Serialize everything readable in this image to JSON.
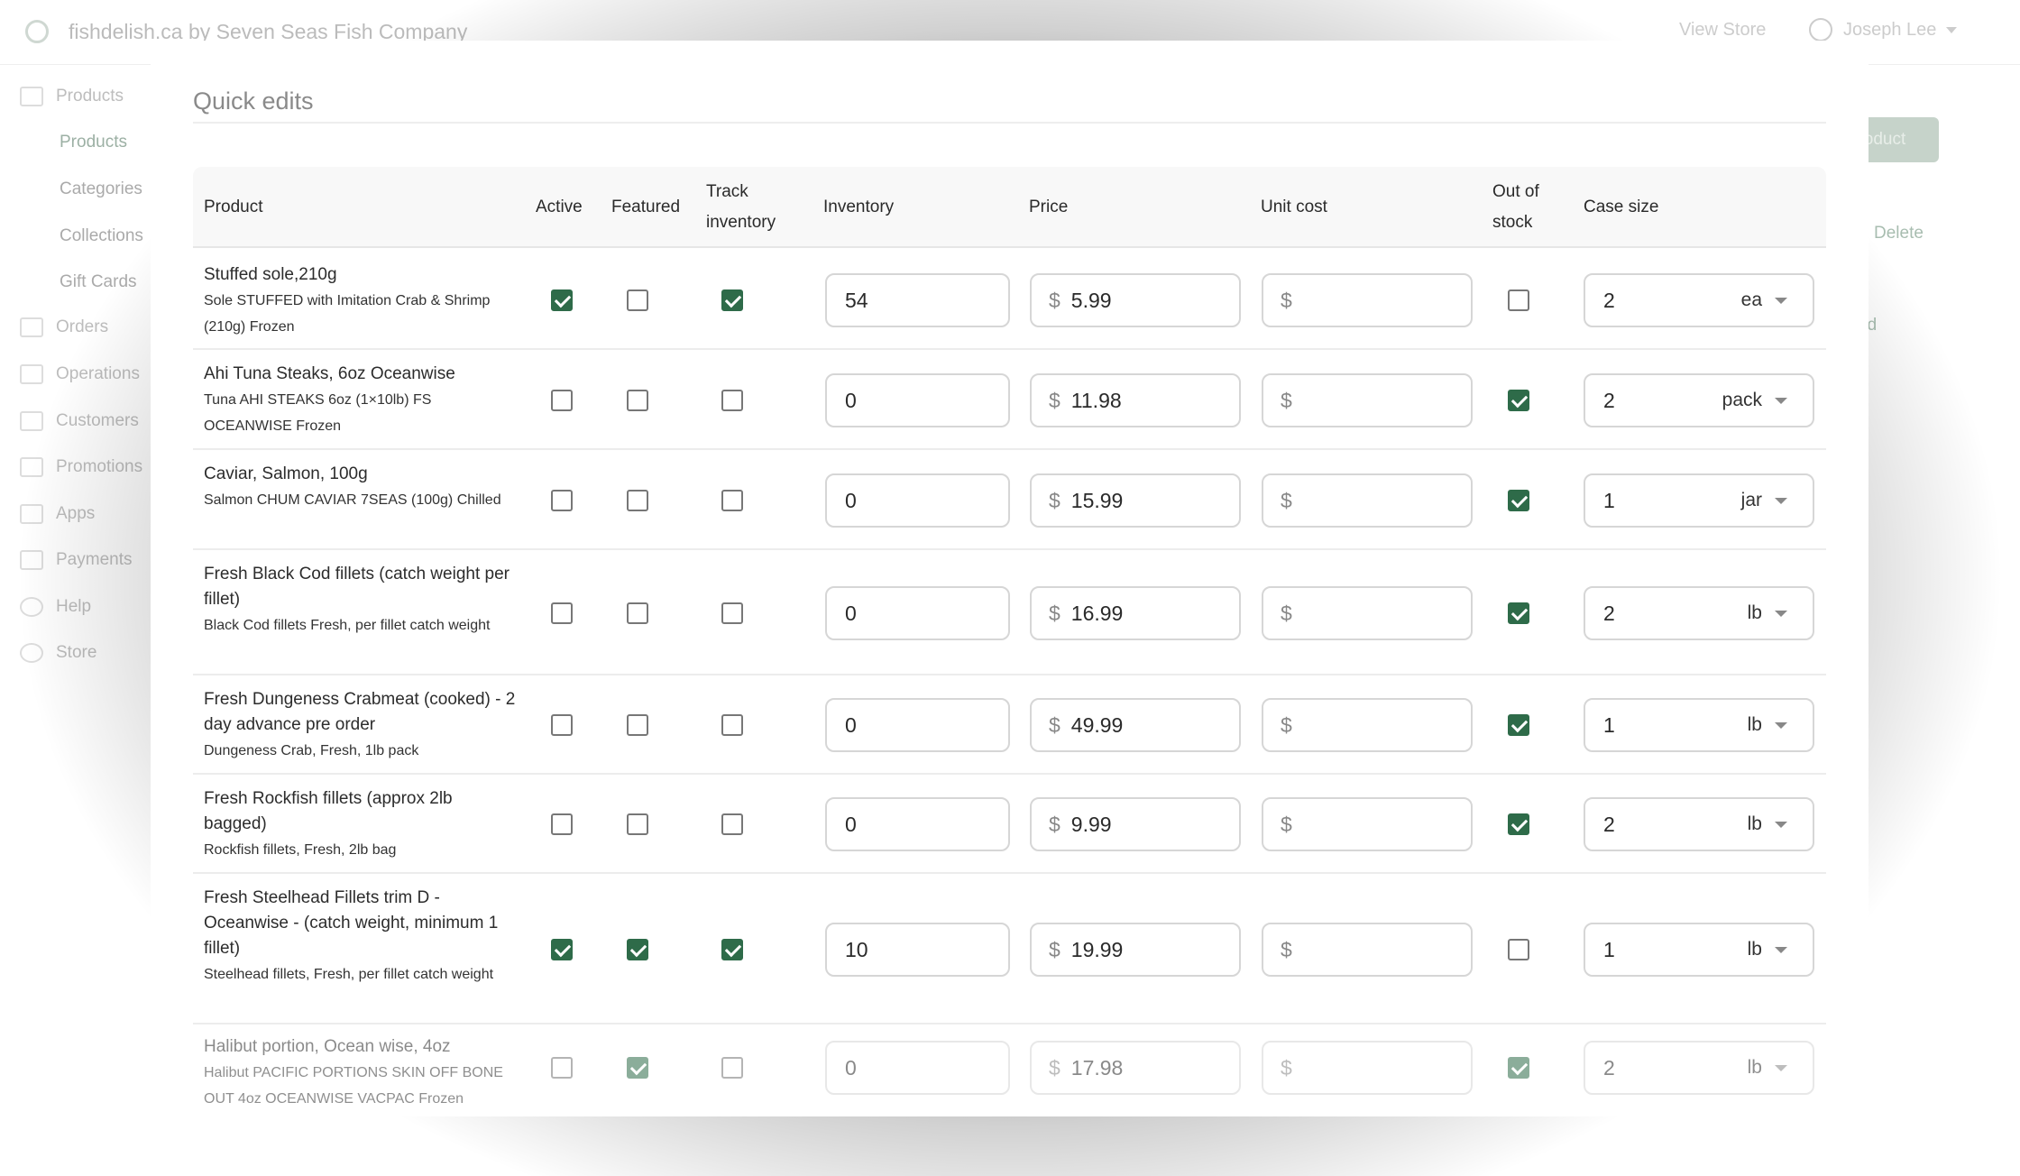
{
  "app": {
    "store_title": "fishdelish.ca by Seven Seas Fish Company",
    "view_store": "View Store",
    "user_name": "Joseph Lee",
    "add_button_label": "oduct",
    "delete_label": "Delete",
    "bg_text_ed": "ed"
  },
  "sidebar": {
    "section": "Products",
    "sub_items": [
      "Products",
      "Categories",
      "Collections",
      "Gift Cards"
    ],
    "items": [
      "Orders",
      "Operations",
      "Customers",
      "Promotions",
      "Apps",
      "Payments",
      "Help",
      "Store"
    ]
  },
  "modal": {
    "title": "Quick edits",
    "columns": {
      "product": "Product",
      "active": "Active",
      "featured": "Featured",
      "track_1": "Track",
      "track_2": "inventory",
      "inventory": "Inventory",
      "price": "Price",
      "unit_cost": "Unit cost",
      "oos_1": "Out of",
      "oos_2": "stock",
      "case_size": "Case size"
    },
    "currency_symbol": "$",
    "rows": [
      {
        "name": "Stuffed sole,210g",
        "desc": "Sole STUFFED with Imitation Crab & Shrimp (210g) Frozen",
        "active": true,
        "featured": false,
        "track": true,
        "inventory": "54",
        "price": "5.99",
        "unit_cost": "",
        "out_of_stock": false,
        "case_qty": "2",
        "case_unit": "ea"
      },
      {
        "name": "Ahi Tuna Steaks, 6oz Oceanwise",
        "desc": "Tuna AHI STEAKS 6oz (1×10lb) FS OCEANWISE Frozen",
        "active": false,
        "featured": false,
        "track": false,
        "inventory": "0",
        "price": "11.98",
        "unit_cost": "",
        "out_of_stock": true,
        "case_qty": "2",
        "case_unit": "pack"
      },
      {
        "name": "Caviar, Salmon, 100g",
        "desc": "Salmon CHUM CAVIAR 7SEAS (100g) Chilled",
        "active": false,
        "featured": false,
        "track": false,
        "inventory": "0",
        "price": "15.99",
        "unit_cost": "",
        "out_of_stock": true,
        "case_qty": "1",
        "case_unit": "jar"
      },
      {
        "name": "Fresh Black Cod fillets (catch weight per fillet)",
        "desc": "Black Cod fillets Fresh, per fillet catch weight",
        "active": false,
        "featured": false,
        "track": false,
        "inventory": "0",
        "price": "16.99",
        "unit_cost": "",
        "out_of_stock": true,
        "case_qty": "2",
        "case_unit": "lb"
      },
      {
        "name": "Fresh Dungeness Crabmeat (cooked) - 2 day advance pre order",
        "desc": "Dungeness Crab, Fresh, 1lb pack",
        "active": false,
        "featured": false,
        "track": false,
        "inventory": "0",
        "price": "49.99",
        "unit_cost": "",
        "out_of_stock": true,
        "case_qty": "1",
        "case_unit": "lb"
      },
      {
        "name": "Fresh Rockfish fillets (approx 2lb bagged)",
        "desc": "Rockfish fillets, Fresh, 2lb bag",
        "active": false,
        "featured": false,
        "track": false,
        "inventory": "0",
        "price": "9.99",
        "unit_cost": "",
        "out_of_stock": true,
        "case_qty": "2",
        "case_unit": "lb"
      },
      {
        "name": "Fresh Steelhead Fillets trim D - Oceanwise - (catch weight, minimum 1 fillet)",
        "desc": "Steelhead fillets, Fresh, per fillet catch weight",
        "active": true,
        "featured": true,
        "track": true,
        "inventory": "10",
        "price": "19.99",
        "unit_cost": "",
        "out_of_stock": false,
        "case_qty": "1",
        "case_unit": "lb"
      },
      {
        "name": "Halibut portion, Ocean wise, 4oz",
        "desc": "Halibut PACIFIC PORTIONS SKIN OFF BONE OUT 4oz OCEANWISE VACPAC Frozen",
        "active": false,
        "featured": true,
        "track": false,
        "inventory": "0",
        "price": "17.98",
        "unit_cost": "",
        "out_of_stock": true,
        "case_qty": "2",
        "case_unit": "lb"
      }
    ]
  },
  "colors": {
    "accent": "#2e6b49",
    "header_bg": "#f8f8f8",
    "border": "#d6d6d6"
  }
}
